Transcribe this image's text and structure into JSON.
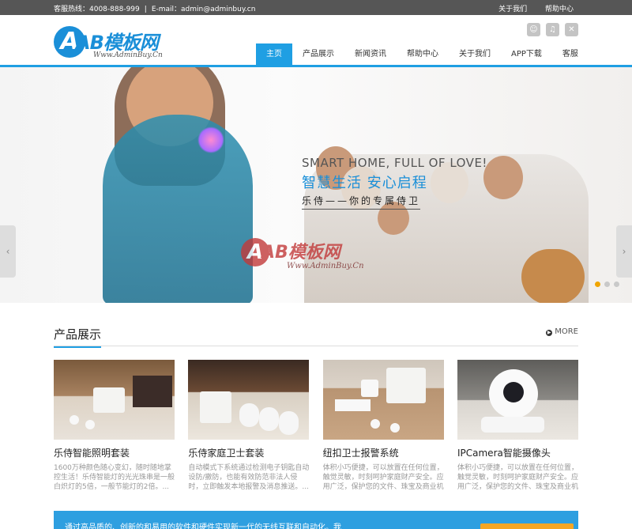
{
  "topbar": {
    "hotline": "客服热线：4008-888-999",
    "email": "E-mail：admin@adminbuy.cn",
    "links": [
      "关于我们",
      "帮助中心"
    ]
  },
  "logo": {
    "mark": "A",
    "brand": "AB模板网",
    "url": "Www.AdminBuy.Cn"
  },
  "social": [
    "☺",
    "♫",
    "✕"
  ],
  "nav": [
    "主页",
    "产品展示",
    "新闻资讯",
    "帮助中心",
    "关于我们",
    "APP下载",
    "客服"
  ],
  "banner": {
    "slogan_en": "SMART HOME, FULL OF LOVE!",
    "slogan_cn": "智慧生活 安心启程",
    "slogan_sub": "乐侍——你的专属侍卫",
    "watermark_brand": "AB模板网",
    "watermark_url": "Www.AdminBuy.Cn",
    "arrow_left": "‹",
    "arrow_right": "›",
    "slide_count": 3,
    "active_slide": 1
  },
  "products": {
    "title": "产品展示",
    "more": "MORE",
    "items": [
      {
        "title": "乐侍智能照明套装",
        "desc": "1600万种颜色随心变幻，随时随地掌控生活！乐侍智能灯的光光珠串是一般白炽灯的5倍，一般节能灯的2倍。..."
      },
      {
        "title": "乐侍家庭卫士套装",
        "desc": "自动模式下系统通过检测电子钥匙自动设防/撤防，也能有效防范非法人侵时，立即触发本地报警及消息推送。..."
      },
      {
        "title": "纽扣卫士报警系统",
        "desc": "体积小巧便捷，可以放置在任何位置，触觉灵敏，时刻呵护家庭财产安全。应用广泛，保护您的文件、珠宝及商业机密。..."
      },
      {
        "title": "IPCamera智能摄像头",
        "desc": "体积小巧便捷，可以放置在任何位置，触觉灵敏，时刻呵护家庭财产安全。应用广泛，保护您的文件、珠宝及商业机密。..."
      }
    ]
  },
  "strip": {
    "text": "通过高品质的、创新的和易用的软件和硬件实现新一代的无线互联和自动化。我"
  },
  "colors": {
    "accent": "#1f9fe3",
    "topbar": "#565656",
    "dot_active": "#f0a500"
  }
}
